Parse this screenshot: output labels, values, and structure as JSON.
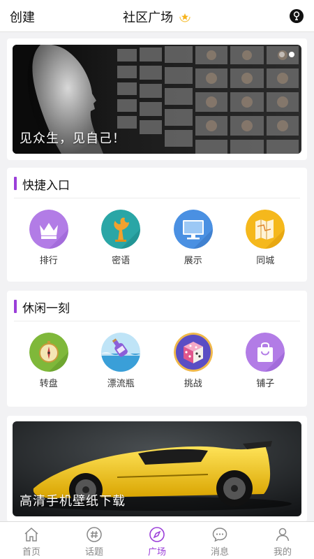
{
  "header": {
    "left_label": "创建",
    "title": "社区广场",
    "right_icon": "bulb-icon"
  },
  "banner": {
    "caption": "见众生，见自己！",
    "dots": 2,
    "active_dot": 1
  },
  "quick_entry": {
    "title": "快捷入口",
    "items": [
      {
        "label": "排行",
        "icon": "crown-icon",
        "color": "#b27ce6"
      },
      {
        "label": "密语",
        "icon": "tree-icon",
        "color": "#2aa6a6"
      },
      {
        "label": "展示",
        "icon": "monitor-icon",
        "color": "#4a90e2"
      },
      {
        "label": "同城",
        "icon": "map-icon",
        "color": "#f5b81c"
      }
    ]
  },
  "leisure": {
    "title": "休闲一刻",
    "items": [
      {
        "label": "转盘",
        "icon": "compass-icon",
        "color": "#7fb83a"
      },
      {
        "label": "漂流瓶",
        "icon": "bottle-icon",
        "color": "#5bb8e8"
      },
      {
        "label": "挑战",
        "icon": "dice-icon",
        "color": "#f0b84a"
      },
      {
        "label": "铺子",
        "icon": "shopping-bag-icon",
        "color": "#b27ce6"
      }
    ]
  },
  "wallpaper": {
    "caption": "高清手机壁纸下载"
  },
  "tabbar": {
    "active_index": 2,
    "accent": "#9b3fd9",
    "tabs": [
      {
        "label": "首页",
        "icon": "home-icon"
      },
      {
        "label": "话题",
        "icon": "hashtag-icon"
      },
      {
        "label": "广场",
        "icon": "compass-nav-icon"
      },
      {
        "label": "消息",
        "icon": "chat-icon"
      },
      {
        "label": "我的",
        "icon": "user-icon"
      }
    ]
  }
}
